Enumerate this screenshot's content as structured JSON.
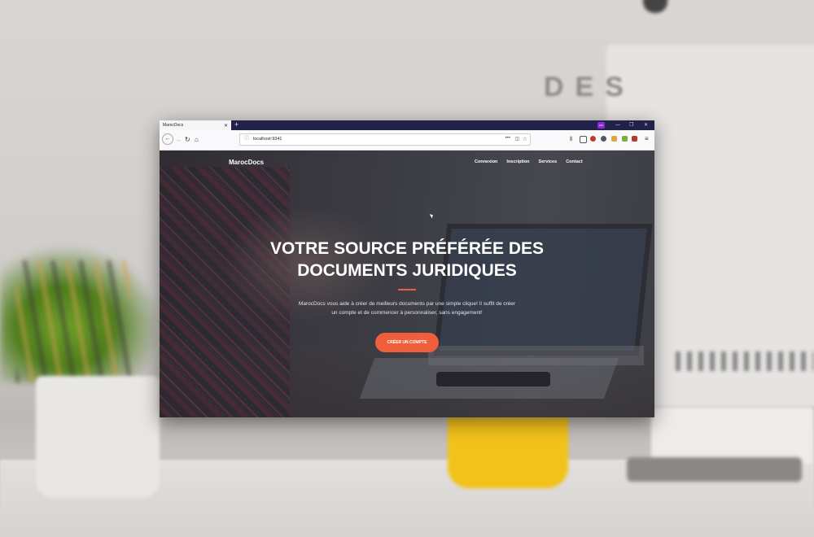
{
  "browser": {
    "tab_title": "MarocDocs",
    "tab_close": "✕",
    "new_tab": "+",
    "extension_badge": "oo",
    "window_controls": {
      "minimize": "—",
      "restore": "❐",
      "close": "✕"
    },
    "url": "localhost:9341",
    "icons": [
      "back-icon",
      "forward-icon",
      "reload-icon",
      "home-icon",
      "info-icon",
      "page-actions-icon",
      "pocket-icon",
      "bookmark-star-icon",
      "library-icon",
      "sidebar-icon",
      "ublock-icon",
      "privacy-icon",
      "extension-icon",
      "download-icon",
      "extension-square-icon",
      "menu-icon"
    ]
  },
  "site": {
    "brand": "MarocDocs",
    "nav": [
      "Connexion",
      "Inscription",
      "Services",
      "Contact"
    ],
    "hero": {
      "title_line1": "VOTRE SOURCE PRÉFÉRÉE DES",
      "title_line2": "DOCUMENTS JURIDIQUES",
      "text_line1": "MarocDocs vous aide à créer de meilleurs documents par une simple clique! Il suffit de créer",
      "text_line2": "un compte et de commencer à personnaliser, sans engagement!",
      "cta": "CRÉER UN COMPTE"
    },
    "colors": {
      "accent": "#f05f3b",
      "titlebar": "#20224a"
    }
  }
}
